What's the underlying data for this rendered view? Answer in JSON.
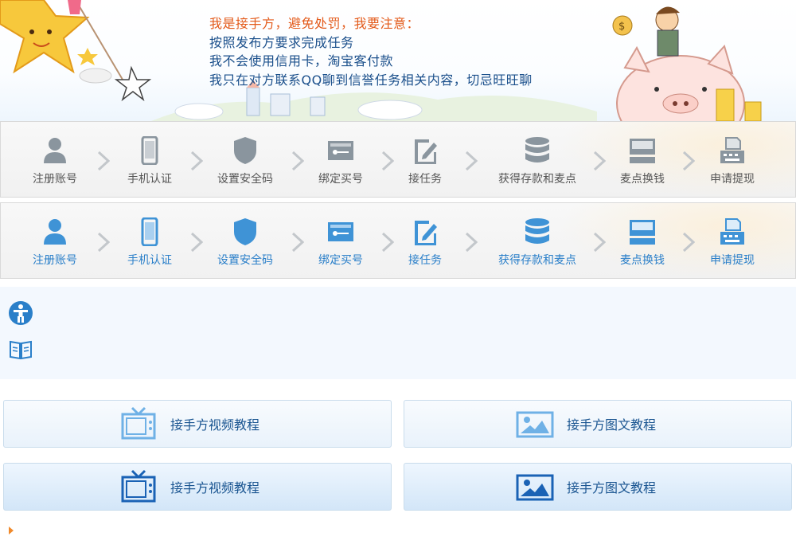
{
  "banner": {
    "warning": "我是接手方，避免处罚，我要注意：",
    "lines": [
      "按照发布方要求完成任务",
      "我不会使用信用卡，淘宝客付款",
      "我只在对方联系QQ聊到信誉任务相关内容，切忌旺旺聊"
    ]
  },
  "steps_gray": [
    {
      "label": "注册账号",
      "icon": "user-icon"
    },
    {
      "label": "手机认证",
      "icon": "phone-icon"
    },
    {
      "label": "设置安全码",
      "icon": "shield-icon"
    },
    {
      "label": "绑定买号",
      "icon": "key-card-icon"
    },
    {
      "label": "接任务",
      "icon": "edit-icon"
    },
    {
      "label": "获得存款和麦点",
      "icon": "database-icon"
    },
    {
      "label": "麦点换钱",
      "icon": "monitor-icon"
    },
    {
      "label": "申请提现",
      "icon": "printer-icon"
    }
  ],
  "steps_blue": [
    {
      "label": "注册账号",
      "icon": "user-icon"
    },
    {
      "label": "手机认证",
      "icon": "phone-icon"
    },
    {
      "label": "设置安全码",
      "icon": "shield-icon"
    },
    {
      "label": "绑定买号",
      "icon": "key-card-icon"
    },
    {
      "label": "接任务",
      "icon": "edit-icon"
    },
    {
      "label": "获得存款和麦点",
      "icon": "database-icon"
    },
    {
      "label": "麦点换钱",
      "icon": "monitor-icon"
    },
    {
      "label": "申请提现",
      "icon": "printer-icon"
    }
  ],
  "info": {
    "icons": [
      "accessibility-icon",
      "book-icon"
    ]
  },
  "tutorials": {
    "video_light": "接手方视频教程",
    "image_light": "接手方图文教程",
    "video_dark": "接手方视频教程",
    "image_dark": "接手方图文教程"
  },
  "colors": {
    "accent_blue": "#2a7fc9",
    "step_gray": "#7f8a94",
    "warning_orange": "#e35a1a",
    "text_blue": "#1a4f8b"
  }
}
